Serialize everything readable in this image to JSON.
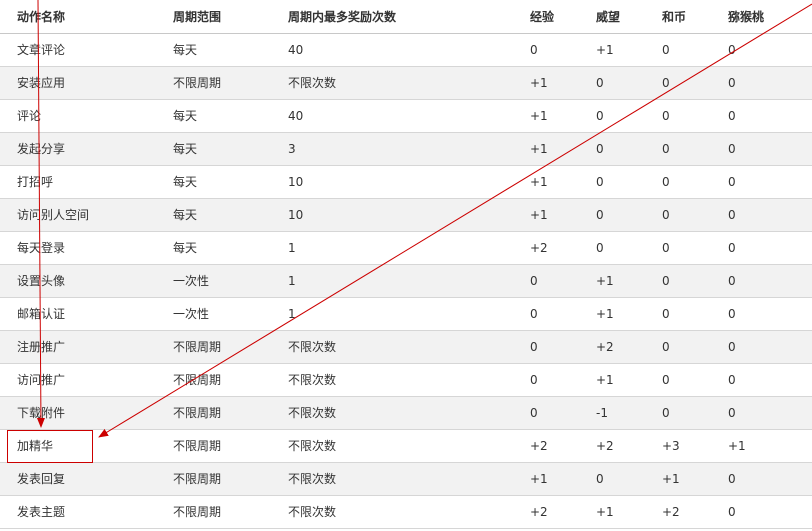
{
  "table": {
    "headers": [
      "动作名称",
      "周期范围",
      "周期内最多奖励次数",
      "经验",
      "威望",
      "和币",
      "猕猴桃"
    ],
    "rows": [
      [
        "文章评论",
        "每天",
        "40",
        "0",
        "+1",
        "0",
        "0"
      ],
      [
        "安装应用",
        "不限周期",
        "不限次数",
        "+1",
        "0",
        "0",
        "0"
      ],
      [
        "评论",
        "每天",
        "40",
        "+1",
        "0",
        "0",
        "0"
      ],
      [
        "发起分享",
        "每天",
        "3",
        "+1",
        "0",
        "0",
        "0"
      ],
      [
        "打招呼",
        "每天",
        "10",
        "+1",
        "0",
        "0",
        "0"
      ],
      [
        "访问别人空间",
        "每天",
        "10",
        "+1",
        "0",
        "0",
        "0"
      ],
      [
        "每天登录",
        "每天",
        "1",
        "+2",
        "0",
        "0",
        "0"
      ],
      [
        "设置头像",
        "一次性",
        "1",
        "0",
        "+1",
        "0",
        "0"
      ],
      [
        "邮箱认证",
        "一次性",
        "1",
        "0",
        "+1",
        "0",
        "0"
      ],
      [
        "注册推广",
        "不限周期",
        "不限次数",
        "0",
        "+2",
        "0",
        "0"
      ],
      [
        "访问推广",
        "不限周期",
        "不限次数",
        "0",
        "+1",
        "0",
        "0"
      ],
      [
        "下载附件",
        "不限周期",
        "不限次数",
        "0",
        "-1",
        "0",
        "0"
      ],
      [
        "加精华",
        "不限周期",
        "不限次数",
        "+2",
        "+2",
        "+3",
        "+1"
      ],
      [
        "发表回复",
        "不限周期",
        "不限次数",
        "+1",
        "0",
        "+1",
        "0"
      ],
      [
        "发表主题",
        "不限周期",
        "不限次数",
        "+2",
        "+1",
        "+2",
        "0"
      ]
    ]
  },
  "annotation": {
    "highlighted_row": "加精华",
    "color": "#cc0000"
  }
}
